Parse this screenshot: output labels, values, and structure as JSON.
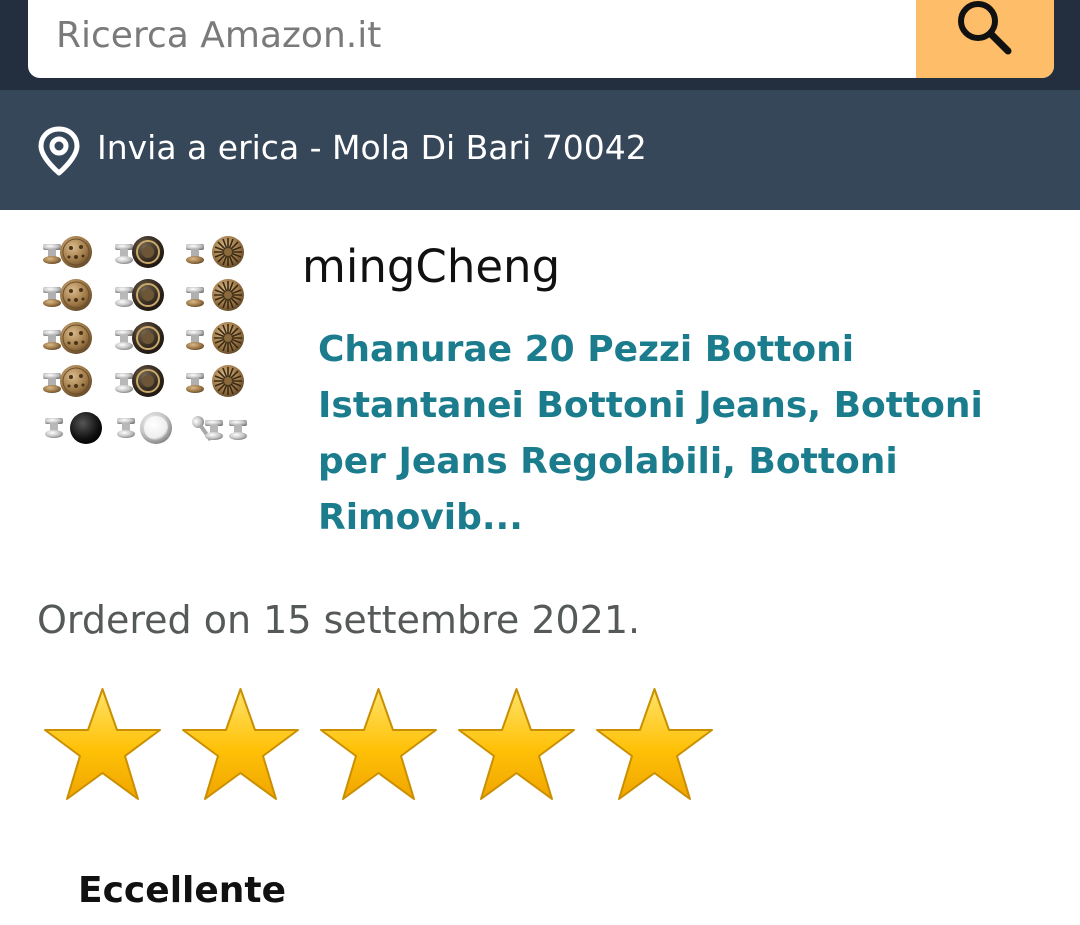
{
  "search": {
    "placeholder": "Ricerca Amazon.it",
    "icon": "search-icon"
  },
  "delivery": {
    "icon": "location-pin-icon",
    "text": "Invia a erica - Mola Di Bari 70042"
  },
  "product": {
    "seller": "mingCheng",
    "title": "Chanurae 20 Pezzi Bottoni Istantanei Bottoni Jeans, Bottoni per Jeans Regolabili, Bottoni Rimovib..."
  },
  "order": {
    "date_text": "Ordered on 15 settembre 2021."
  },
  "rating": {
    "value": 5,
    "max": 5,
    "label": "Eccellente"
  },
  "colors": {
    "header_bg": "#232f3e",
    "delivery_bg": "#37475a",
    "search_button": "#febd69",
    "title_link": "#1a7c8c",
    "star_fill": "#ffc107"
  }
}
